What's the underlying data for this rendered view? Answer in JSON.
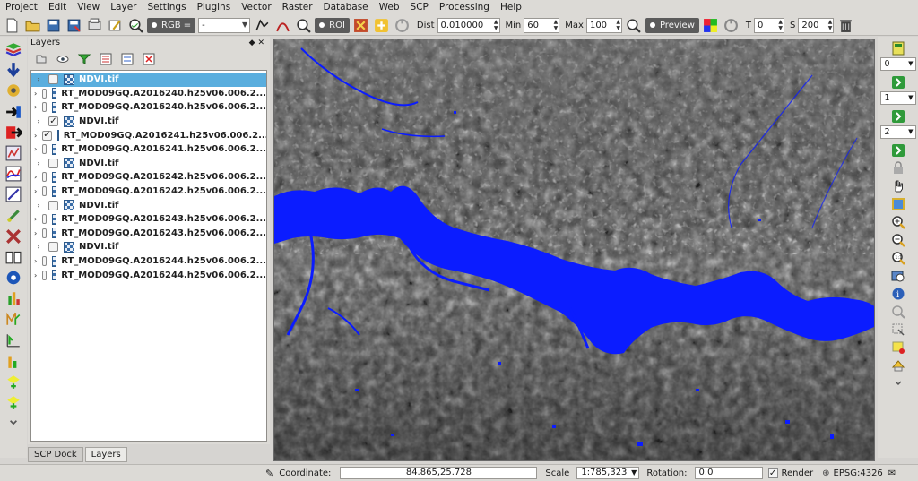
{
  "menu": [
    "Project",
    "Edit",
    "View",
    "Layer",
    "Settings",
    "Plugins",
    "Vector",
    "Raster",
    "Database",
    "Web",
    "SCP",
    "Processing",
    "Help"
  ],
  "toolbar": {
    "band_combo": "RGB =",
    "band_value": "-",
    "roi_label": "ROI",
    "dist_label": "Dist",
    "dist_value": "0.010000",
    "min_label": "Min",
    "min_value": "60",
    "max_label": "Max",
    "max_value": "100",
    "preview_label": "Preview",
    "t_label": "T",
    "t_value": "0",
    "s_label": "S",
    "s_value": "200"
  },
  "layers_panel": {
    "title": "Layers",
    "controls": "◆ ✕",
    "layers": [
      {
        "name": "NDVI.tif",
        "checked": false,
        "selected": true
      },
      {
        "name": "RT_MOD09GQ.A2016240.h25v06.006.2...",
        "checked": false,
        "selected": false
      },
      {
        "name": "RT_MOD09GQ.A2016240.h25v06.006.2...",
        "checked": false,
        "selected": false
      },
      {
        "name": "NDVI.tif",
        "checked": true,
        "selected": false
      },
      {
        "name": "RT_MOD09GQ.A2016241.h25v06.006.2...",
        "checked": true,
        "selected": false
      },
      {
        "name": "RT_MOD09GQ.A2016241.h25v06.006.2...",
        "checked": false,
        "selected": false
      },
      {
        "name": "NDVI.tif",
        "checked": false,
        "selected": false
      },
      {
        "name": "RT_MOD09GQ.A2016242.h25v06.006.2...",
        "checked": false,
        "selected": false
      },
      {
        "name": "RT_MOD09GQ.A2016242.h25v06.006.2...",
        "checked": false,
        "selected": false
      },
      {
        "name": "NDVI.tif",
        "checked": false,
        "selected": false
      },
      {
        "name": "RT_MOD09GQ.A2016243.h25v06.006.2...",
        "checked": false,
        "selected": false
      },
      {
        "name": "RT_MOD09GQ.A2016243.h25v06.006.2...",
        "checked": false,
        "selected": false
      },
      {
        "name": "NDVI.tif",
        "checked": false,
        "selected": false
      },
      {
        "name": "RT_MOD09GQ.A2016244.h25v06.006.2...",
        "checked": false,
        "selected": false
      },
      {
        "name": "RT_MOD09GQ.A2016244.h25v06.006.2...",
        "checked": false,
        "selected": false
      }
    ]
  },
  "dock_tabs": [
    "SCP Dock",
    "Layers"
  ],
  "right_spins": [
    "0",
    "1",
    "2"
  ],
  "status": {
    "coordinate_label": "Coordinate:",
    "coordinate_value": "84.865,25.728",
    "scale_label": "Scale",
    "scale_value": "1:785,323",
    "rotation_label": "Rotation:",
    "rotation_value": "0.0",
    "render_label": "Render",
    "crs": "EPSG:4326"
  },
  "colors": {
    "water_mask": "#0b1cff",
    "selection": "#5aaede"
  }
}
